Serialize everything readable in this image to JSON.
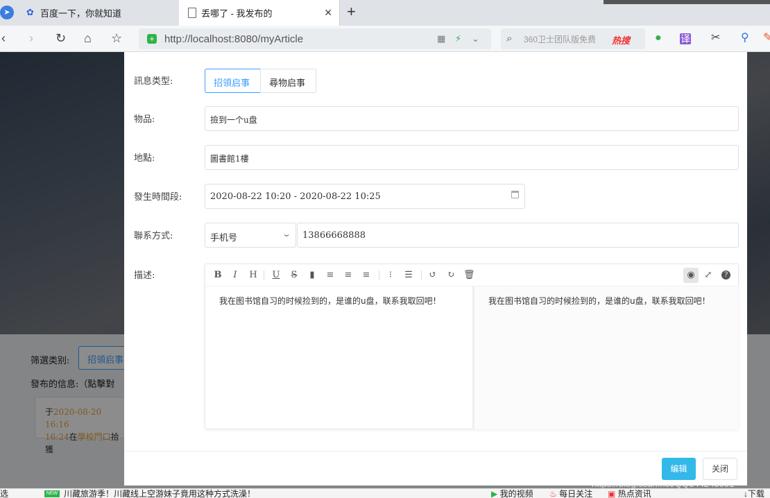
{
  "browser": {
    "tabs": [
      {
        "title": "百度一下，你就知道"
      },
      {
        "title": "丢哪了 - 我发布的"
      }
    ],
    "url_scheme_host": "http://localhost",
    "url_rest": ":8080/myArticle",
    "search_placeholder": "360卫士团队版免费",
    "hot_label": "热搜"
  },
  "background": {
    "filter_label": "筛選类别:",
    "filter_button": "招領启事",
    "published_label": "發布的信息:（點擊對",
    "card_line1_prefix": "于",
    "card_line1_time": "2020-08-20 16:16",
    "card_line2_time": "16:24",
    "card_line2_mid": "在",
    "card_line2_place": "學校門口",
    "card_line2_suffix": "拾獲"
  },
  "dialog": {
    "type_label": "訊息类型:",
    "type_options": [
      "招領启事",
      "尋物启事"
    ],
    "item_label": "物品:",
    "item_value": "撿到一个u盘",
    "place_label": "地點:",
    "place_value": "圖書館1樓",
    "time_label": "發生時間段:",
    "time_value": "2020-08-22 10:20 - 2020-08-22 10:25",
    "contact_label": "聯系方式:",
    "contact_type": "手机号",
    "contact_value": "13866668888",
    "desc_label": "描述:",
    "desc_text": "我在图书馆自习的时候捡到的，是谁的u盘，联系我取回吧！",
    "preview_text": "我在图书馆自习的时候捡到的，是谁的u盘，联系我取回吧！",
    "edit_button": "编辑",
    "close_button": "关闭"
  },
  "statusbar": {
    "left_text": "选",
    "new_badge": "NEW",
    "news": "川藏旅游季！川藏线上空游妹子竟用这种方式洗澡！",
    "my_video": "我的视频",
    "daily": "每日关注",
    "hot": "热点资讯",
    "download": "下载"
  },
  "watermark": "https://blog.csdn.net/QQ344245001",
  "colors": {
    "primary": "#409eff",
    "edit_button": "#33b8ea",
    "highlight": "#e6a23c"
  }
}
